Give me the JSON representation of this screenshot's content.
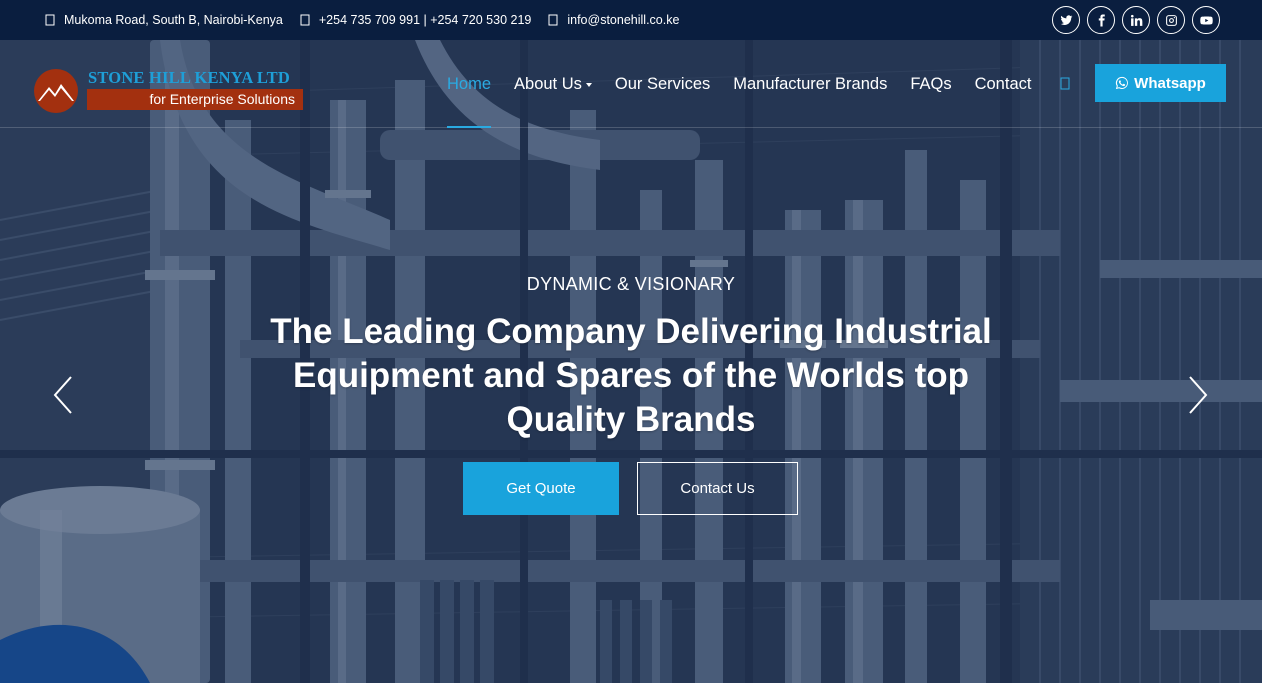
{
  "topbar": {
    "address": "Mukoma Road, South B, Nairobi-Kenya",
    "phones": "+254 735 709 991 | +254 720 530 219",
    "email": "info@stonehill.co.ke",
    "address_icon": "map-marker-icon",
    "phone_icon": "phone-icon",
    "email_icon": "envelope-icon",
    "socials": [
      "twitter-icon",
      "facebook-icon",
      "linkedin-icon",
      "instagram-icon",
      "youtube-icon"
    ]
  },
  "logo": {
    "name": "STONE HILL KENYA LTD",
    "tagline": "for Enterprise Solutions"
  },
  "nav": {
    "items": [
      "Home",
      "About Us",
      "Our Services",
      "Manufacturer Brands",
      "FAQs",
      "Contact"
    ],
    "active": "Home",
    "whatsapp_label": "Whatsapp"
  },
  "hero": {
    "kicker": "DYNAMIC & VISIONARY",
    "headline": "The Leading Company Delivering Industrial Equipment and Spares of the Worlds top Quality Brands",
    "primary_cta": "Get Quote",
    "secondary_cta": "Contact Us"
  },
  "colors": {
    "topbar_bg": "#0a1e3f",
    "accent": "#19a3dc",
    "brand_red": "#a3300f",
    "brand_blue": "#1e9fd8"
  }
}
